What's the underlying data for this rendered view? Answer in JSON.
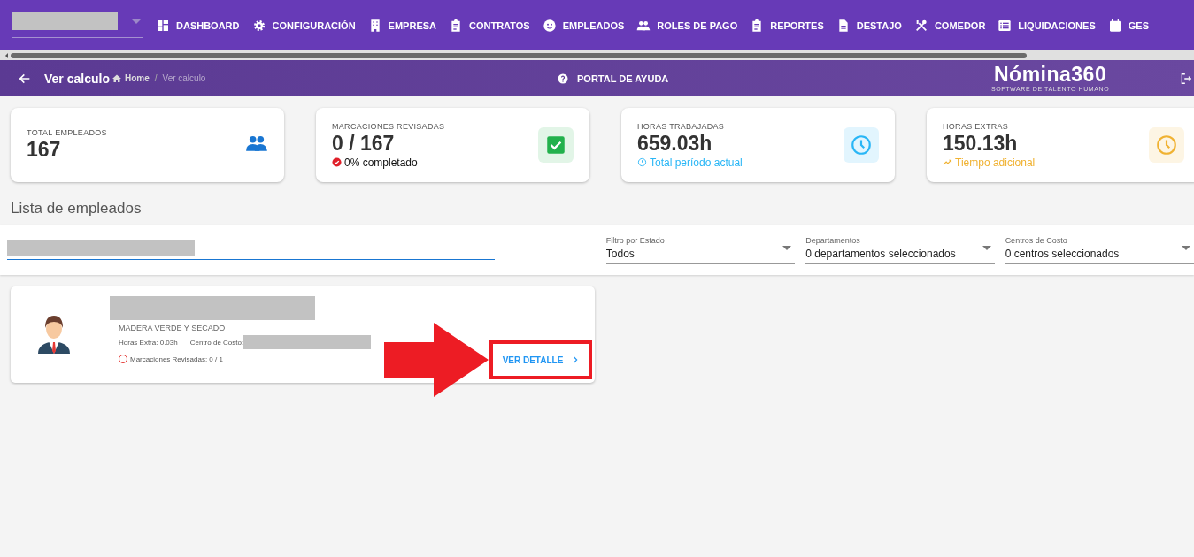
{
  "nav": {
    "items": [
      {
        "label": "DASHBOARD",
        "kind": "grid"
      },
      {
        "label": "CONFIGURACIÓN",
        "kind": "gear"
      },
      {
        "label": "EMPRESA",
        "kind": "building"
      },
      {
        "label": "CONTRATOS",
        "kind": "clipboard"
      },
      {
        "label": "EMPLEADOS",
        "kind": "face"
      },
      {
        "label": "ROLES DE PAGO",
        "kind": "people"
      },
      {
        "label": "REPORTES",
        "kind": "clipboard"
      },
      {
        "label": "DESTAJO",
        "kind": "document"
      },
      {
        "label": "COMEDOR",
        "kind": "utensils"
      },
      {
        "label": "LIQUIDACIONES",
        "kind": "list"
      },
      {
        "label": "GES",
        "kind": "calendar"
      }
    ]
  },
  "header": {
    "title": "Ver calculo",
    "breadcrumb": [
      "Home",
      "Ver calculo"
    ],
    "breadcrumb_separator": "/",
    "help": "PORTAL DE AYUDA",
    "logo": "Nómina360",
    "logo_tagline": "SOFTWARE DE TALENTO HUMANO"
  },
  "stats": [
    {
      "label": "TOTAL EMPLEADOS",
      "value": "167",
      "kind": "people",
      "color": "#1976d2"
    },
    {
      "label": "MARCACIONES REVISADAS",
      "value": "0 / 167",
      "sub": "0% completado",
      "kind": "check",
      "color": "#22b14c"
    },
    {
      "label": "HORAS TRABAJADAS",
      "value": "659.03h",
      "sub": "Total período actual",
      "kind": "hours",
      "color": "#29b6f6"
    },
    {
      "label": "HORAS EXTRAS",
      "value": "150.13h",
      "sub": "Tiempo adicional",
      "kind": "extra",
      "color": "#f0b232"
    }
  ],
  "section_title": "Lista de empleados",
  "filters": [
    {
      "label": "Filtro por Estado",
      "value": "Todos"
    },
    {
      "label": "Departamentos",
      "value": "0 departamentos seleccionados"
    },
    {
      "label": "Centros de Costo",
      "value": "0 centros seleccionados"
    }
  ],
  "employees": [
    {
      "department": "MADERA VERDE Y SECADO",
      "extra_hours": "Horas Extra: 0.03h",
      "cost_center_label": "Centro de Costo:",
      "reviewed": "Marcaciones Revisadas: 0 / 1",
      "reviewed_done": false,
      "action": "VER DETALLE",
      "highlighted": true
    }
  ]
}
